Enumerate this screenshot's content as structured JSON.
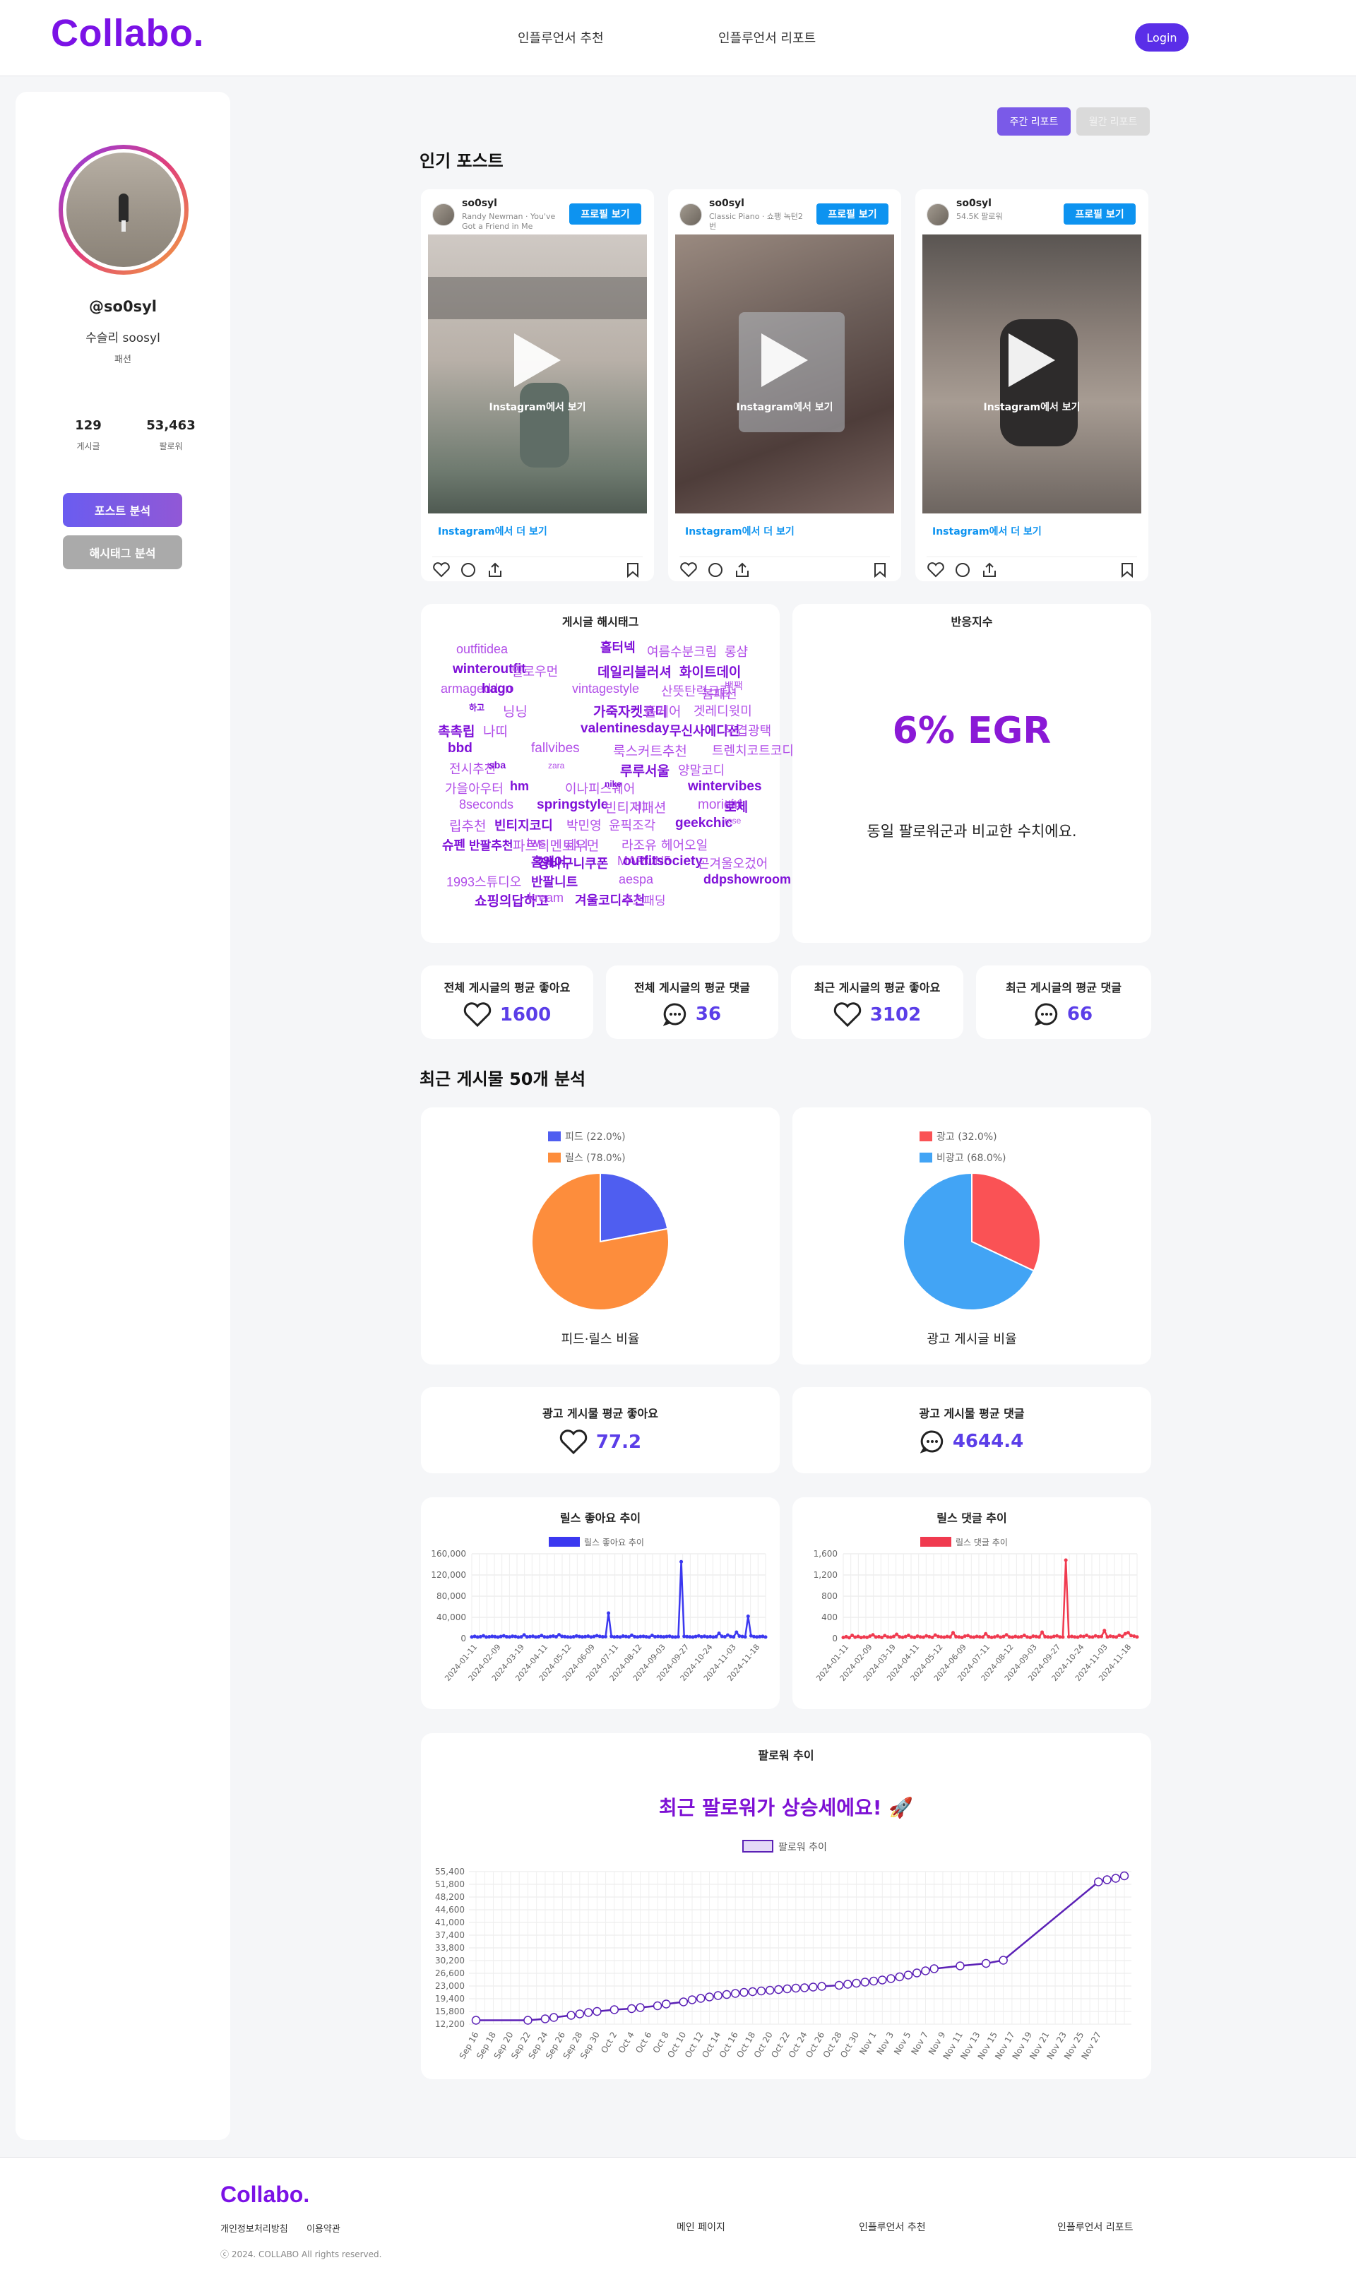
{
  "header": {
    "logo": "Collabo.",
    "nav": [
      "인플루언서 추천",
      "인플루언서 리포트"
    ],
    "login": "Login"
  },
  "profile": {
    "handle": "@so0syl",
    "name": "수슬리 soosyl",
    "category": "패션",
    "posts_value": "129",
    "posts_label": "게시글",
    "followers_value": "53,463",
    "followers_label": "팔로워",
    "btn_post_analysis": "포스트 분석",
    "btn_hashtag_analysis": "해시태그 분석"
  },
  "tabs": {
    "weekly": "주간 리포트",
    "monthly": "월간 리포트"
  },
  "popular": {
    "title": "인기 포스트",
    "profile_btn": "프로필 보기",
    "instagram_view": "Instagram에서 보기",
    "instagram_more": "Instagram에서 더 보기",
    "posts": [
      {
        "user": "so0syl",
        "sub": "Randy Newman · You've Got a Friend in Me"
      },
      {
        "user": "so0syl",
        "sub": "Classic Piano · 쇼팽 녹턴2번"
      },
      {
        "user": "so0syl",
        "sub": "54.5K 팔로워"
      }
    ]
  },
  "hashtags": {
    "title": "게시글 해시태그",
    "tags": [
      "outfitidea",
      "홀터넥",
      "여름수분크림",
      "롱샴",
      "winteroutfit",
      "밀로우먼",
      "데일리블러셔",
      "화이트데이",
      "armageddon",
      "hago",
      "vintagestyle",
      "산뜻탄력크림",
      "봄패션",
      "백팩",
      "하고",
      "닝닝",
      "가죽자켓코디",
      "홀케어",
      "겟레디윗미",
      "촉촉립",
      "나띠",
      "valentinesday",
      "무신사에디션",
      "두겹광택",
      "bbd",
      "fallvibes",
      "룩스커트추천",
      "트렌치코트코디",
      "전시추천",
      "sba",
      "zara",
      "루루서울",
      "양말코디",
      "가을아우터",
      "hm",
      "이나피스퀘어",
      "nike",
      "wintervibes",
      "8seconds",
      "springstyle",
      "빈티지패션",
      "비",
      "morigirl",
      "비비",
      "로제",
      "립추천",
      "빈티지코디",
      "박민영",
      "윤픽조각",
      "geekchic",
      "rose",
      "슈펜",
      "반팔추천",
      "tws",
      "홈웨어",
      "제니",
      "라조유",
      "헤어오일",
      "파르티멘토우먼",
      "장바구니쿠폰",
      "MARUN5",
      "outfitsociety",
      "곤겨울오겄어",
      "1993스튜디오",
      "반팔니트",
      "aespa",
      "ddpshowroom",
      "쇼핑의답하고",
      "kream",
      "겨울코디추천",
      "구스패딩"
    ]
  },
  "engagement": {
    "title": "반응지수",
    "value": "6% EGR",
    "desc": "동일 팔로워군과 비교한 수치에요."
  },
  "averages": [
    {
      "label": "전체 게시글의 평균 좋아요",
      "value": "1600",
      "icon": "heart-icon"
    },
    {
      "label": "전체 게시글의 평균 댓글",
      "value": "36",
      "icon": "comment-icon"
    },
    {
      "label": "최근 게시글의 평균 좋아요",
      "value": "3102",
      "icon": "heart-icon"
    },
    {
      "label": "최근 게시글의 평균 댓글",
      "value": "66",
      "icon": "comment-icon"
    }
  ],
  "recent": {
    "title": "최근 게시물 50개 분석",
    "ad_likes_label": "광고 게시물 평균 좋아요",
    "ad_likes_value": "77.2",
    "ad_comments_label": "광고 게시물 평균 댓글",
    "ad_comments_value": "4644.4"
  },
  "chart_data": [
    {
      "type": "pie",
      "title": "피드·릴스 비율",
      "labels": [
        "피드 (22.0%)",
        "릴스 (78.0%)"
      ],
      "values": [
        22,
        78
      ],
      "colors": [
        "#4f5ef0",
        "#fd8d3c"
      ]
    },
    {
      "type": "pie",
      "title": "광고 게시글 비율",
      "labels": [
        "광고 (32.0%)",
        "비광고 (68.0%)"
      ],
      "values": [
        32,
        68
      ],
      "colors": [
        "#fa5255",
        "#42a4f5"
      ]
    },
    {
      "type": "line",
      "title": "릴스 좋아요 추이",
      "series": [
        {
          "name": "릴스 좋아요 추이",
          "color": "#3b38f0"
        }
      ],
      "ylim": [
        0,
        160000
      ],
      "yticks": [
        "0",
        "40,000",
        "80,000",
        "120,000",
        "160,000"
      ],
      "xticks": [
        "2024-01-11",
        "2024-02-09",
        "2024-03-19",
        "2024-04-11",
        "2024-05-12",
        "2024-06-09",
        "2024-07-11",
        "2024-08-12",
        "2024-09-03",
        "2024-09-27",
        "2024-10-24",
        "2024-11-03",
        "2024-11-18"
      ],
      "values": [
        3000,
        4200,
        2800,
        3500,
        5200,
        2900,
        3300,
        4100,
        3600,
        2700,
        3900,
        5100,
        3400,
        3000,
        4400,
        3800,
        2600,
        3200,
        6800,
        3100,
        3700,
        4300,
        2900,
        3500,
        5600,
        3200,
        2800,
        3900,
        4700,
        3300,
        7200,
        4100,
        3600,
        3000,
        2700,
        3400,
        4800,
        3900,
        3100,
        3600,
        4500,
        2900,
        3800,
        5300,
        4200,
        3300,
        3700,
        48000,
        4100,
        3000,
        3500,
        2800,
        4600,
        3900,
        3200,
        6100,
        3500,
        3000,
        3800,
        4200,
        3300,
        2700,
        5800,
        3400,
        4000,
        3600,
        3100,
        3900,
        4400,
        3000,
        2900,
        3500,
        145000,
        4100,
        3600,
        3200,
        2800,
        3900,
        5000,
        3400,
        4300,
        3100,
        3700,
        2900,
        3600,
        9800,
        4200,
        3300,
        6500,
        3800,
        3100,
        12000,
        4600,
        3900,
        3200,
        42000,
        5100,
        3700,
        3000,
        3600,
        4100,
        2800
      ]
    },
    {
      "type": "line",
      "title": "릴스 댓글 추이",
      "series": [
        {
          "name": "릴스 댓글 추이",
          "color": "#f03a4f"
        }
      ],
      "ylim": [
        0,
        1600
      ],
      "yticks": [
        "0",
        "400",
        "800",
        "1,200",
        "1,600"
      ],
      "xticks": [
        "2024-01-11",
        "2024-02-09",
        "2024-03-19",
        "2024-04-11",
        "2024-05-12",
        "2024-06-09",
        "2024-07-11",
        "2024-08-12",
        "2024-09-03",
        "2024-09-27",
        "2024-10-24",
        "2024-11-03",
        "2024-11-18"
      ],
      "values": [
        20,
        35,
        15,
        60,
        25,
        40,
        18,
        30,
        22,
        45,
        70,
        28,
        35,
        20,
        55,
        30,
        25,
        40,
        80,
        32,
        24,
        38,
        60,
        28,
        20,
        45,
        30,
        25,
        50,
        35,
        22,
        65,
        40,
        30,
        25,
        38,
        28,
        110,
        35,
        30,
        20,
        45,
        55,
        30,
        25,
        40,
        32,
        28,
        90,
        35,
        22,
        30,
        48,
        25,
        38,
        70,
        30,
        25,
        40,
        28,
        35,
        60,
        30,
        20,
        45,
        38,
        28,
        120,
        35,
        30,
        25,
        40,
        50,
        30,
        28,
        1480,
        35,
        40,
        30,
        25,
        45,
        38,
        60,
        30,
        28,
        50,
        35,
        40,
        150,
        30,
        45,
        35,
        28,
        60,
        40,
        90,
        110,
        55,
        45,
        30
      ]
    },
    {
      "type": "line",
      "title": "팔로워 추이",
      "series": [
        {
          "name": "팔로워 추이",
          "color": "#5b21b6"
        }
      ],
      "ylim": [
        12200,
        55400
      ],
      "yticks": [
        "12,200",
        "15,800",
        "19,400",
        "23,000",
        "26,600",
        "30,200",
        "33,800",
        "37,400",
        "41,000",
        "44,600",
        "48,200",
        "51,800",
        "55,400"
      ],
      "xticks": [
        "Sep 16",
        "Sep 18",
        "Sep 20",
        "Sep 22",
        "Sep 24",
        "Sep 26",
        "Sep 28",
        "Sep 30",
        "Oct 2",
        "Oct 4",
        "Oct 6",
        "Oct 8",
        "Oct 10",
        "Oct 12",
        "Oct 14",
        "Oct 16",
        "Oct 18",
        "Oct 20",
        "Oct 22",
        "Oct 24",
        "Oct 26",
        "Oct 28",
        "Oct 30",
        "Nov 1",
        "Nov 3",
        "Nov 5",
        "Nov 7",
        "Nov 9",
        "Nov 11",
        "Nov 13",
        "Nov 15",
        "Nov 17",
        "Nov 19",
        "Nov 21",
        "Nov 23",
        "Nov 25",
        "Nov 27"
      ],
      "points": [
        [
          0,
          13300
        ],
        [
          6,
          13300
        ],
        [
          8,
          13700
        ],
        [
          9,
          14100
        ],
        [
          11,
          14700
        ],
        [
          12,
          15100
        ],
        [
          13,
          15500
        ],
        [
          14,
          15800
        ],
        [
          16,
          16300
        ],
        [
          18,
          16600
        ],
        [
          19,
          16900
        ],
        [
          21,
          17400
        ],
        [
          22,
          17900
        ],
        [
          24,
          18500
        ],
        [
          25,
          19100
        ],
        [
          26,
          19500
        ],
        [
          27,
          19900
        ],
        [
          28,
          20300
        ],
        [
          29,
          20600
        ],
        [
          30,
          20900
        ],
        [
          31,
          21200
        ],
        [
          32,
          21400
        ],
        [
          33,
          21600
        ],
        [
          34,
          21800
        ],
        [
          35,
          22000
        ],
        [
          36,
          22200
        ],
        [
          37,
          22400
        ],
        [
          38,
          22500
        ],
        [
          39,
          22700
        ],
        [
          40,
          22900
        ],
        [
          42,
          23200
        ],
        [
          43,
          23500
        ],
        [
          44,
          23800
        ],
        [
          45,
          24100
        ],
        [
          46,
          24400
        ],
        [
          47,
          24700
        ],
        [
          48,
          25100
        ],
        [
          49,
          25600
        ],
        [
          50,
          26100
        ],
        [
          51,
          26700
        ],
        [
          52,
          27300
        ],
        [
          53,
          27900
        ],
        [
          56,
          28700
        ],
        [
          59,
          29400
        ],
        [
          61,
          30300
        ],
        [
          72,
          52500
        ],
        [
          73,
          53100
        ],
        [
          74,
          53500
        ],
        [
          75,
          54200
        ]
      ]
    }
  ],
  "follower_card": {
    "title": "팔로워 추이",
    "headline": "최근 팔로워가 상승세에요! 🚀"
  },
  "footer": {
    "logo": "Collabo.",
    "privacy": "개인정보처리방침",
    "terms": "이용약관",
    "copyright": "ⓒ 2024. COLLABO All rights reserved.",
    "links": [
      "메인 페이지",
      "인플루언서 추천",
      "인플루언서 리포트"
    ]
  }
}
